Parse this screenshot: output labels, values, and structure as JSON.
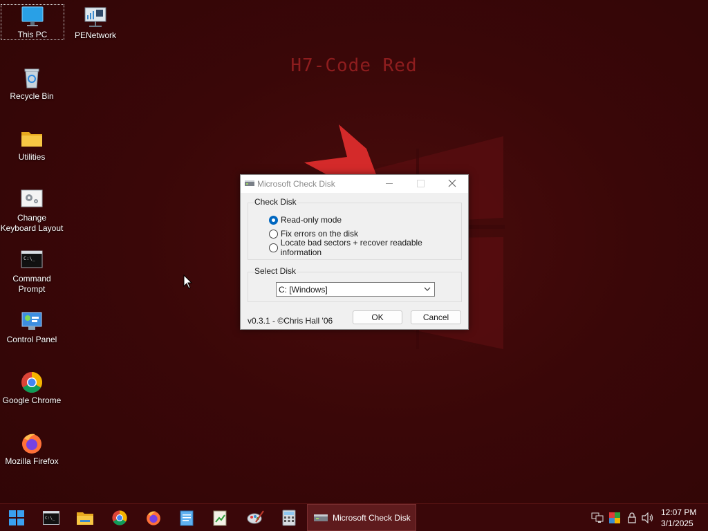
{
  "wallpaper": {
    "title": "H7-Code Red"
  },
  "desktop_icons": [
    {
      "label": "This PC",
      "icon": "monitor-icon",
      "selected": true
    },
    {
      "label": "PENetwork",
      "icon": "network-icon"
    },
    {
      "label": "Recycle Bin",
      "icon": "recycle-bin-icon"
    },
    {
      "label": "Utilities",
      "icon": "folder-icon"
    },
    {
      "label": "Change Keyboard Layout",
      "icon": "keyboard-settings-icon"
    },
    {
      "label": "Command Prompt",
      "icon": "terminal-icon"
    },
    {
      "label": "Control Panel",
      "icon": "control-panel-icon"
    },
    {
      "label": "Google Chrome",
      "icon": "chrome-icon"
    },
    {
      "label": "Mozilla Firefox",
      "icon": "firefox-icon"
    }
  ],
  "dialog": {
    "title": "Microsoft Check Disk",
    "check_group": {
      "title": "Check Disk",
      "options": [
        {
          "label": "Read-only mode",
          "checked": true
        },
        {
          "label": "Fix errors on the disk",
          "checked": false
        },
        {
          "label": "Locate bad sectors + recover readable information",
          "checked": false
        }
      ]
    },
    "disk_group": {
      "title": "Select Disk",
      "selected": "C: [Windows]"
    },
    "version": "v0.3.1 - ©Chris Hall '06",
    "ok_label": "OK",
    "cancel_label": "Cancel"
  },
  "taskbar": {
    "active_window": "Microsoft Check Disk",
    "pinned": [
      "start-icon",
      "terminal-icon",
      "file-explorer-icon",
      "chrome-icon",
      "firefox-icon",
      "notepad-icon",
      "editor-icon",
      "paint-icon",
      "calculator-icon"
    ],
    "tray": [
      "network-icon",
      "display-icon",
      "security-icon",
      "volume-icon"
    ],
    "time": "12:07 PM",
    "date": "3/1/2025"
  },
  "colors": {
    "accent": "#0067c0",
    "background": "#3a0708",
    "wallpaper_text": "#8e1d1e"
  }
}
